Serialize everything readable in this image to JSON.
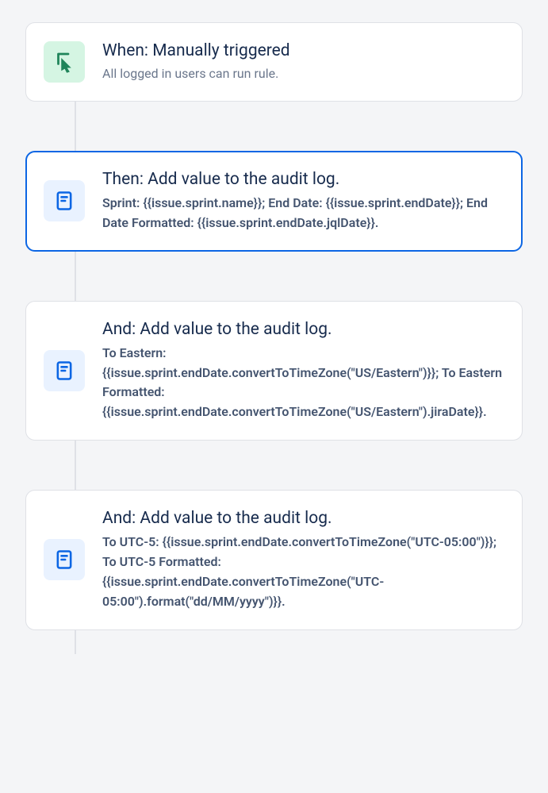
{
  "trigger": {
    "title": "When: Manually triggered",
    "subtitle": "All logged in users can run rule."
  },
  "steps": [
    {
      "title": "Then: Add value to the audit log.",
      "desc": "Sprint: {{issue.sprint.name}}; End Date: {{issue.sprint.endDate}}; End Date Formatted: {{issue.sprint.endDate.jqlDate}}.",
      "selected": true
    },
    {
      "title": "And: Add value to the audit log.",
      "desc": "To Eastern: {{issue.sprint.endDate.convertToTimeZone(\"US/Eastern\")}}; To Eastern Formatted: {{issue.sprint.endDate.convertToTimeZone(\"US/Eastern\").jiraDate}}.",
      "selected": false
    },
    {
      "title": "And: Add value to the audit log.",
      "desc": "To UTC-5: {{issue.sprint.endDate.convertToTimeZone(\"UTC-05:00\")}}; To UTC-5 Formatted: {{issue.sprint.endDate.convertToTimeZone(\"UTC-05:00\").format(\"dd/MM/yyyy\")}}.",
      "selected": false
    }
  ]
}
